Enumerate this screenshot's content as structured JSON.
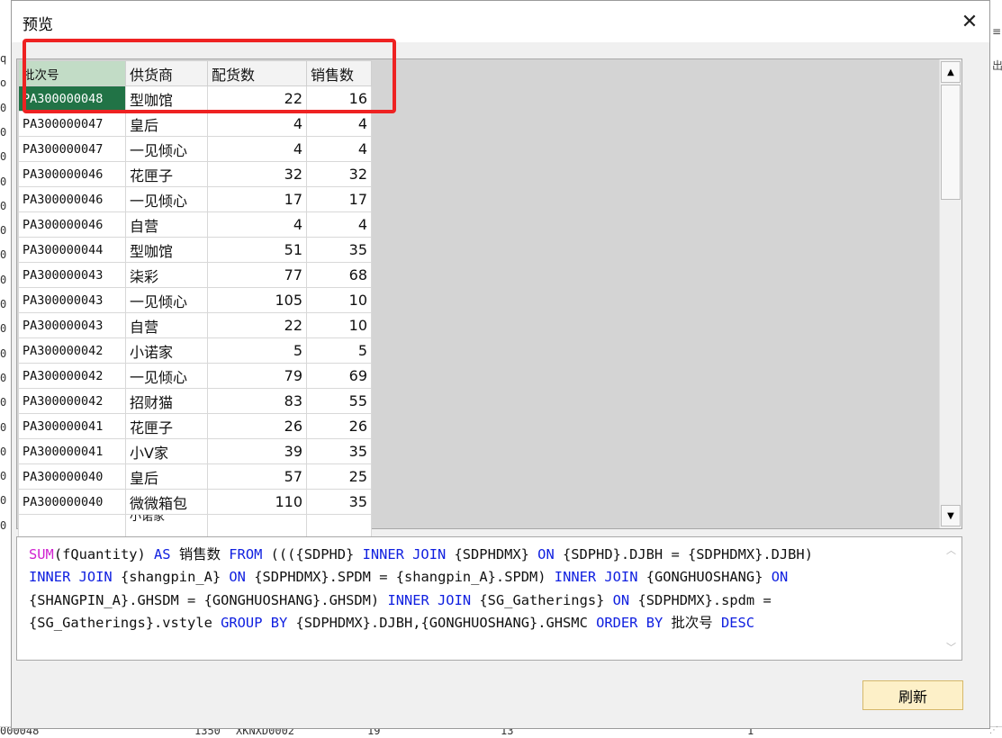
{
  "dialog": {
    "title": "预览",
    "close_symbol": "✕",
    "refresh_label": "刷新"
  },
  "grid": {
    "columns": [
      "批次号",
      "供货商",
      "配货数",
      "销售数"
    ],
    "rows": [
      [
        "PA300000048",
        "型咖馆",
        "22",
        "16"
      ],
      [
        "PA300000047",
        "皇后",
        "4",
        "4"
      ],
      [
        "PA300000047",
        "一见倾心",
        "4",
        "4"
      ],
      [
        "PA300000046",
        "花匣子",
        "32",
        "32"
      ],
      [
        "PA300000046",
        "一见倾心",
        "17",
        "17"
      ],
      [
        "PA300000046",
        "自营",
        "4",
        "4"
      ],
      [
        "PA300000044",
        "型咖馆",
        "51",
        "35"
      ],
      [
        "PA300000043",
        "柒彩",
        "77",
        "68"
      ],
      [
        "PA300000043",
        "一见倾心",
        "105",
        "10"
      ],
      [
        "PA300000043",
        "自营",
        "22",
        "10"
      ],
      [
        "PA300000042",
        "小诺家",
        "5",
        "5"
      ],
      [
        "PA300000042",
        "一见倾心",
        "79",
        "69"
      ],
      [
        "PA300000042",
        "招财猫",
        "83",
        "55"
      ],
      [
        "PA300000041",
        "花匣子",
        "26",
        "26"
      ],
      [
        "PA300000041",
        "小V家",
        "39",
        "35"
      ],
      [
        "PA300000040",
        "皇后",
        "57",
        "25"
      ],
      [
        "PA300000040",
        "微微箱包",
        "110",
        "35"
      ]
    ],
    "partial_row": [
      "",
      "小诺家",
      "",
      ""
    ],
    "scroll_up": "▲",
    "scroll_down": "▼"
  },
  "sql": {
    "lines": [
      [
        [
          "fn",
          "SUM"
        ],
        [
          "t",
          "(fQuantity) "
        ],
        [
          "kw",
          "AS"
        ],
        [
          "t",
          " 销售数 "
        ],
        [
          "kw",
          "FROM"
        ],
        [
          "t",
          " ((({SDPHD} "
        ],
        [
          "kw",
          "INNER JOIN"
        ],
        [
          "t",
          " {SDPHDMX} "
        ],
        [
          "kw",
          "ON"
        ],
        [
          "t",
          " {SDPHD}.DJBH = {SDPHDMX}.DJBH)"
        ]
      ],
      [
        [
          "kw",
          "INNER JOIN"
        ],
        [
          "t",
          " {shangpin_A} "
        ],
        [
          "kw",
          "ON"
        ],
        [
          "t",
          " {SDPHDMX}.SPDM = {shangpin_A}.SPDM) "
        ],
        [
          "kw",
          "INNER JOIN"
        ],
        [
          "t",
          " {GONGHUOSHANG} "
        ],
        [
          "kw",
          "ON"
        ]
      ],
      [
        [
          "t",
          "{SHANGPIN_A}.GHSDM = {GONGHUOSHANG}.GHSDM) "
        ],
        [
          "kw",
          "INNER JOIN"
        ],
        [
          "t",
          " {SG_Gatherings} "
        ],
        [
          "kw",
          "ON"
        ],
        [
          "t",
          " {SDPHDMX}.spdm ="
        ]
      ],
      [
        [
          "t",
          "{SG_Gatherings}.vstyle "
        ],
        [
          "kw",
          "GROUP BY"
        ],
        [
          "t",
          " {SDPHDMX}.DJBH,{GONGHUOSHANG}.GHSMC "
        ],
        [
          "kw",
          "ORDER BY"
        ],
        [
          "t",
          " 批次号 "
        ],
        [
          "kw",
          "DESC"
        ]
      ]
    ]
  },
  "background": {
    "left_glyphs": [
      "q",
      "o",
      "0",
      "0",
      "0",
      "0",
      "0",
      "0",
      "0",
      "0",
      "0",
      "0",
      "0",
      "0",
      "0",
      "0",
      "0",
      "0",
      "0",
      "0"
    ],
    "right_glyphs": [
      "≡",
      "出"
    ],
    "bottom_cells": [
      "000048",
      "1350",
      "XKNXD0002",
      "19",
      "13",
      "1"
    ]
  }
}
